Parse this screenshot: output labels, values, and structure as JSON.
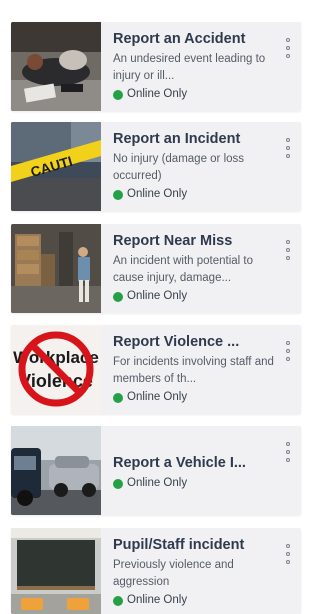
{
  "reports": [
    {
      "title": "Report an Accident",
      "description": "An undesired event leading to injury or ill...",
      "status": "Online Only",
      "thumbnail": "accident-photo"
    },
    {
      "title": "Report an Incident",
      "description": "No injury (damage or loss occurred)",
      "status": "Online Only",
      "thumbnail": "caution-tape-photo",
      "tape_text": "CAUTI"
    },
    {
      "title": "Report Near Miss",
      "description": "An incident with potential to cause injury, damage...",
      "status": "Online Only",
      "thumbnail": "warehouse-photo"
    },
    {
      "title": "Report Violence ...",
      "description": "For incidents involving staff and members of th...",
      "status": "Online Only",
      "thumbnail": "workplace-violence-sign",
      "sign_text_1": "Workplace",
      "sign_text_2": "Violence"
    },
    {
      "title": "Report a Vehicle I...",
      "description": "",
      "status": "Online Only",
      "thumbnail": "car-crash-photo"
    },
    {
      "title": "Pupil/Staff incident",
      "description": "Previously violence and aggression",
      "status": "Online Only",
      "thumbnail": "classroom-photo"
    }
  ],
  "colors": {
    "status_dot": "#24a146",
    "title": "#2f3a4d",
    "card_bg": "#f1f1f3"
  }
}
